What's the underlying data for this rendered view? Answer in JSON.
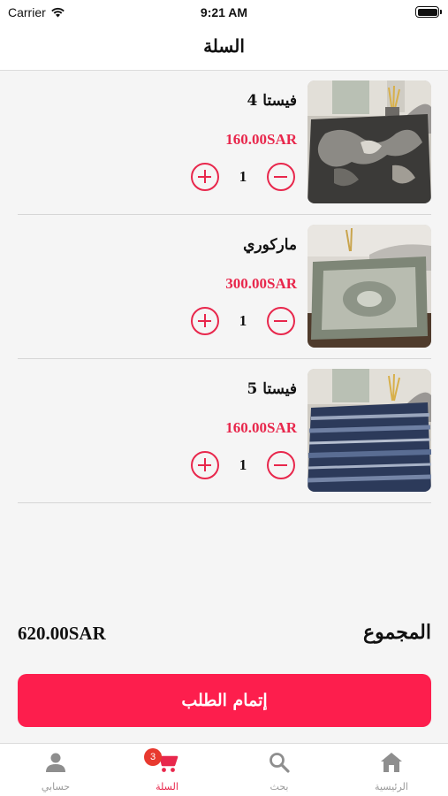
{
  "status_bar": {
    "carrier": "Carrier",
    "time": "9:21 AM"
  },
  "header": {
    "title": "السلة"
  },
  "cart": {
    "items": [
      {
        "name": "فيستا 4",
        "price": "160.00SAR",
        "quantity": "1"
      },
      {
        "name": "ماركوري",
        "price": "300.00SAR",
        "quantity": "1"
      },
      {
        "name": "فيستا 5",
        "price": "160.00SAR",
        "quantity": "1"
      }
    ]
  },
  "summary": {
    "total_label": "المجموع",
    "total_value": "620.00SAR"
  },
  "checkout": {
    "label": "إتمام الطلب"
  },
  "tabbar": {
    "items": [
      {
        "label": "حسابي",
        "icon": "person-icon"
      },
      {
        "label": "السلة",
        "icon": "cart-icon",
        "badge": "3",
        "active": true
      },
      {
        "label": "بحث",
        "icon": "search-icon"
      },
      {
        "label": "الرئيسية",
        "icon": "home-icon"
      }
    ]
  },
  "colors": {
    "accent": "#e8274c",
    "button": "#fd1e4d",
    "badge": "#e8392f"
  }
}
